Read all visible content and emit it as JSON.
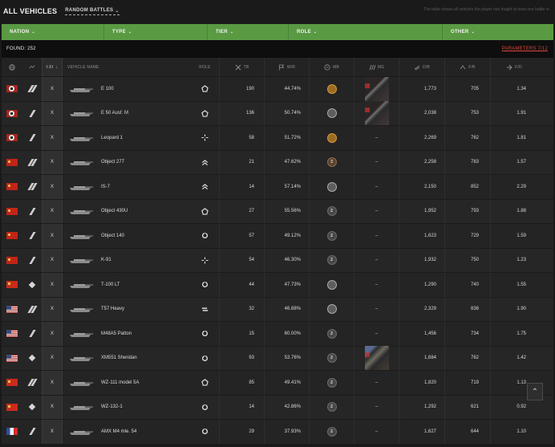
{
  "header": {
    "title": "ALL VEHICLES",
    "battle_mode": "RANDOM BATTLES",
    "hint": "The table shows all vehicles the player has fought at least one battle in."
  },
  "filters": [
    {
      "label": "NATION"
    },
    {
      "label": "TYPE"
    },
    {
      "label": "TIER"
    },
    {
      "label": "ROLE"
    },
    {
      "label": "OTHER"
    }
  ],
  "found": "FOUND: 252",
  "parameters": "PARAMETERS 7/12",
  "columns": {
    "tier": "I-XI",
    "name": "VEHICLE NAME",
    "role": "ROLE",
    "tb": "TB",
    "wr": "W/R",
    "mb": "MB",
    "mg": "MG",
    "ds": "D/B",
    "fb": "F/B",
    "fd": "F/D"
  },
  "colors": {
    "filter_bar": "#5a9a43",
    "params_link": "#d9483a"
  },
  "rows": [
    {
      "nation": "germany",
      "cls": "heavy",
      "tier": "X",
      "name": "E 100",
      "role": "pentagon-role-icon",
      "tb": "190",
      "wr": "44.74%",
      "mb": "gold",
      "mb_text": "",
      "mg": "image",
      "ds": "1,773",
      "fb": "705",
      "fd": "1.34"
    },
    {
      "nation": "germany",
      "cls": "medium",
      "tier": "X",
      "name": "E 50 Ausf. M",
      "role": "pentagon-role-icon",
      "tb": "136",
      "wr": "50.74%",
      "mb": "silver",
      "mb_text": "",
      "mg": "image",
      "ds": "2,038",
      "fb": "753",
      "fd": "1.91"
    },
    {
      "nation": "germany",
      "cls": "medium",
      "tier": "X",
      "name": "Leopard 1",
      "role": "crosshair-role-icon",
      "tb": "58",
      "wr": "51.72%",
      "mb": "gold",
      "mb_text": "",
      "mg": "–",
      "ds": "2,269",
      "fb": "762",
      "fd": "1.81"
    },
    {
      "nation": "ussr",
      "cls": "heavy",
      "tier": "X",
      "name": "Object 277",
      "role": "chevron-role-icon",
      "tb": "21",
      "wr": "47.62%",
      "mb": "bronze",
      "mb_text": "3",
      "mg": "–",
      "ds": "2,258",
      "fb": "783",
      "fd": "1.57"
    },
    {
      "nation": "ussr",
      "cls": "heavy",
      "tier": "X",
      "name": "IS-7",
      "role": "chevron-role-icon",
      "tb": "14",
      "wr": "57.14%",
      "mb": "silver",
      "mb_text": "",
      "mg": "–",
      "ds": "2,150",
      "fb": "852",
      "fd": "2.29"
    },
    {
      "nation": "ussr",
      "cls": "medium",
      "tier": "X",
      "name": "Object 430U",
      "role": "pentagon-role-icon",
      "tb": "27",
      "wr": "55.56%",
      "mb": "plain",
      "mb_text": "2",
      "mg": "–",
      "ds": "1,952",
      "fb": "793",
      "fd": "1.88"
    },
    {
      "nation": "ussr",
      "cls": "medium",
      "tier": "X",
      "name": "Object 140",
      "role": "circle-role-icon",
      "tb": "57",
      "wr": "49.12%",
      "mb": "plain",
      "mb_text": "2",
      "mg": "–",
      "ds": "1,623",
      "fb": "729",
      "fd": "1.59"
    },
    {
      "nation": "ussr",
      "cls": "medium",
      "tier": "X",
      "name": "K-91",
      "role": "crosshair-role-icon",
      "tb": "54",
      "wr": "46.30%",
      "mb": "plain",
      "mb_text": "2",
      "mg": "–",
      "ds": "1,932",
      "fb": "750",
      "fd": "1.23"
    },
    {
      "nation": "china",
      "cls": "light",
      "tier": "X",
      "name": "T-100 LT",
      "role": "circle-role-icon",
      "tb": "44",
      "wr": "47.73%",
      "mb": "silver",
      "mb_text": "",
      "mg": "–",
      "ds": "1,290",
      "fb": "740",
      "fd": "1.55"
    },
    {
      "nation": "usa",
      "cls": "heavy",
      "tier": "X",
      "name": "T57 Heavy",
      "role": "bars-role-icon",
      "tb": "32",
      "wr": "46.88%",
      "mb": "silver",
      "mb_text": "",
      "mg": "–",
      "ds": "2,329",
      "fb": "836",
      "fd": "1.90"
    },
    {
      "nation": "usa",
      "cls": "medium",
      "tier": "X",
      "name": "M48A5 Patton",
      "role": "circle-role-icon",
      "tb": "15",
      "wr": "60.00%",
      "mb": "plain",
      "mb_text": "2",
      "mg": "–",
      "ds": "1,456",
      "fb": "734",
      "fd": "1.75"
    },
    {
      "nation": "usa",
      "cls": "light",
      "tier": "X",
      "name": "XM551 Sheridan",
      "role": "circle-role-icon",
      "tb": "93",
      "wr": "53.76%",
      "mb": "plain",
      "mb_text": "2",
      "mg": "image",
      "ds": "1,684",
      "fb": "762",
      "fd": "1.42"
    },
    {
      "nation": "china",
      "cls": "heavy",
      "tier": "X",
      "name": "WZ-111 model 5A",
      "role": "pentagon-role-icon",
      "tb": "85",
      "wr": "49.41%",
      "mb": "plain",
      "mb_text": "2",
      "mg": "–",
      "ds": "1,820",
      "fb": "719",
      "fd": "1.13"
    },
    {
      "nation": "china",
      "cls": "light",
      "tier": "X",
      "name": "WZ-132-1",
      "role": "circle-role-icon",
      "tb": "14",
      "wr": "42.86%",
      "mb": "plain",
      "mb_text": "2",
      "mg": "–",
      "ds": "1,292",
      "fb": "621",
      "fd": "0.92"
    },
    {
      "nation": "france",
      "cls": "medium",
      "tier": "X",
      "name": "AMX M4 mle. 54",
      "role": "circle-role-icon",
      "tb": "29",
      "wr": "37.93%",
      "mb": "plain",
      "mb_text": "2",
      "mg": "–",
      "ds": "1,627",
      "fb": "644",
      "fd": "1.10"
    }
  ]
}
